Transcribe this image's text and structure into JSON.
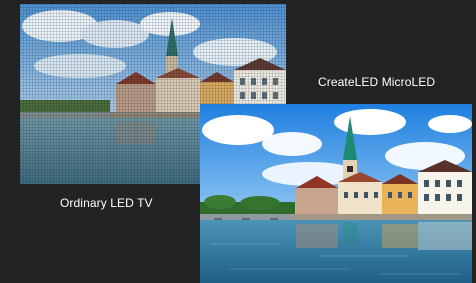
{
  "comparison": {
    "left_caption": "Ordinary LED TV",
    "right_caption": "CreateLED MicroLED"
  },
  "images": {
    "ordinary": {
      "description_icon": "city-river-photo-icon",
      "quality": "pixelated / grid-mesh overlay"
    },
    "microled": {
      "description_icon": "city-river-photo-icon",
      "quality": "sharp / vivid"
    }
  },
  "colors": {
    "background": "#232323",
    "caption_text": "#ffffff"
  }
}
